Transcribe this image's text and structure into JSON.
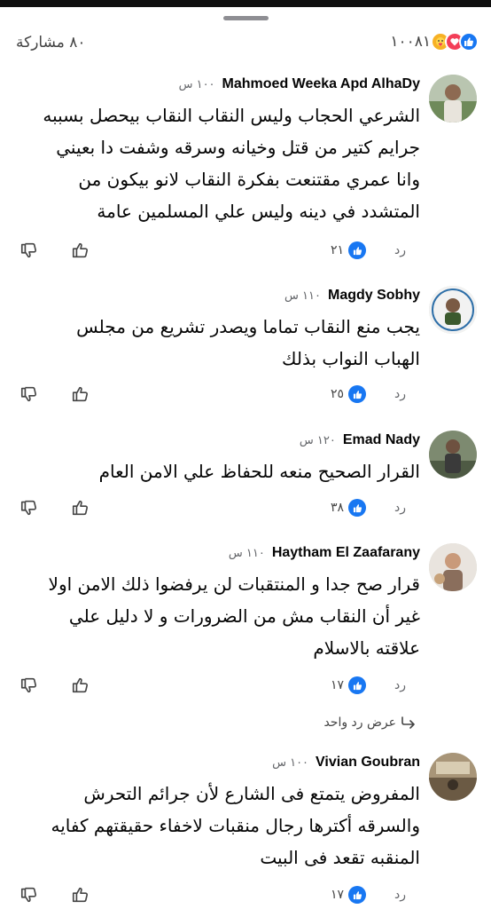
{
  "summary": {
    "shares": "٨٠ مشاركة",
    "reaction_count": "١٠٠٨١",
    "reaction_icons": [
      "care-icon",
      "love-icon",
      "like-icon"
    ]
  },
  "comments": [
    {
      "author": "Mahmoed Weeka Apd AlhaDy",
      "time": "١٠٠ س",
      "lines": [
        "الشرعي الحجاب وليس النقاب النقاب بيحصل بسببه",
        "جرايم كتير من قتل وخيانه وسرقه وشفت دا بعيني",
        "وانا عمري مقتنعت بفكرة النقاب لانو بيكون من",
        "المتشدد في دينه وليس علي المسلمين عامة"
      ],
      "likes": "٢١",
      "reply_label": "رد"
    },
    {
      "author": "Magdy Sobhy",
      "time": "١١٠ س",
      "lines": [
        "يجب منع النقاب تماما ويصدر تشريع من مجلس",
        "الهباب النواب بذلك"
      ],
      "likes": "٢٥",
      "reply_label": "رد"
    },
    {
      "author": "Emad Nady",
      "time": "١٢٠ س",
      "lines": [
        "القرار الصحيح منعه للحفاظ علي الامن العام"
      ],
      "likes": "٣٨",
      "reply_label": "رد"
    },
    {
      "author": "Haytham El Zaafarany",
      "time": "١١٠ س",
      "lines": [
        "قرار صح جدا و المنتقبات لن يرفضوا ذلك الامن اولا",
        "غير أن النقاب مش من الضرورات و لا دليل علي",
        "علاقته بالاسلام"
      ],
      "likes": "١٧",
      "reply_label": "رد",
      "view_replies": "عرض رد واحد"
    },
    {
      "author": "Vivian Goubran",
      "time": "١٠٠ س",
      "lines": [
        "المفروض يتمتع فى الشارع لأن جرائم التحرش",
        "والسرقه أكترها رجال منقبات لاخفاء حقيقتهم كفايه",
        "المنقبه تقعد فى البيت"
      ],
      "likes": "١٧",
      "reply_label": "رد"
    }
  ],
  "colors": {
    "accent": "#1877f2",
    "secondary_text": "#65676b"
  }
}
